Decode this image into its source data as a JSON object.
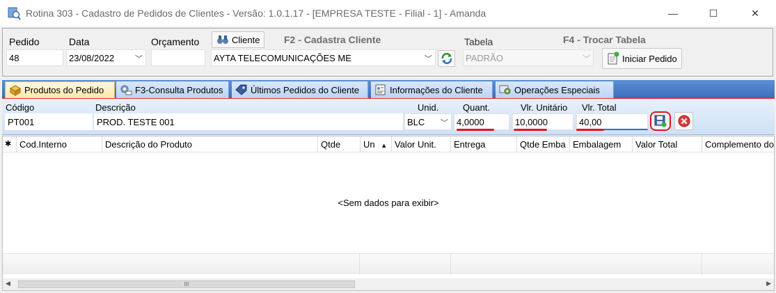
{
  "window": {
    "title": "Rotina 303 - Cadastro de Pedidos de Clientes - Versão: 1.0.1.17 - [EMPRESA TESTE - Filial - 1] - Amanda",
    "min_glyph": "—",
    "max_glyph": "☐",
    "close_glyph": "✕"
  },
  "header": {
    "pedido_label": "Pedido",
    "pedido_value": "48",
    "data_label": "Data",
    "data_value": "23/08/2022",
    "orcamento_label": "Orçamento",
    "orcamento_value": "",
    "cliente_button": "Cliente",
    "f2_label": "F2 - Cadastra Cliente",
    "cliente_value": "AYTA TELECOMUNICAÇÕES ME",
    "tabela_label": "Tabela",
    "f4_label": "F4 - Trocar Tabela",
    "tabela_value": "PADRÃO",
    "iniciar_button": "Iniciar Pedido"
  },
  "tabs": [
    {
      "label": "Produtos do Pedido",
      "icon": "box-icon",
      "active": true
    },
    {
      "label": "F3-Consulta Produtos",
      "icon": "gear-icon",
      "active": false
    },
    {
      "label": "Últimos Pedidos do Cliente",
      "icon": "tag-icon",
      "active": false
    },
    {
      "label": "Informações do Cliente",
      "icon": "id-card-icon",
      "active": false
    },
    {
      "label": "Operações Especiais",
      "icon": "settings-icon",
      "active": false
    }
  ],
  "item": {
    "codigo_label": "Código",
    "codigo_value": "PT001",
    "descricao_label": "Descrição",
    "descricao_value": "PROD. TESTE 001",
    "unid_label": "Unid.",
    "unid_value": "BLC",
    "quant_label": "Quant.",
    "quant_value": "4,0000",
    "vlr_unit_label": "Vlr. Unitário",
    "vlr_unit_value": "10,0000",
    "vlr_total_label": "Vlr. Total",
    "vlr_total_value": "40,00"
  },
  "grid": {
    "star": "✱",
    "columns": [
      "Cod.Interno",
      "Descrição do Produto",
      "Qtde",
      "Un",
      "Valor Unit.",
      "Entrega",
      "Qtde Emba",
      "Embalagem",
      "Valor Total",
      "Complemento do"
    ],
    "sort_glyph": "▲",
    "empty_text": "<Sem dados para exibir>",
    "scroll_grip": "III"
  },
  "colors": {
    "tab_strip": "#4a7cc8",
    "highlight_red": "#e0141c"
  }
}
